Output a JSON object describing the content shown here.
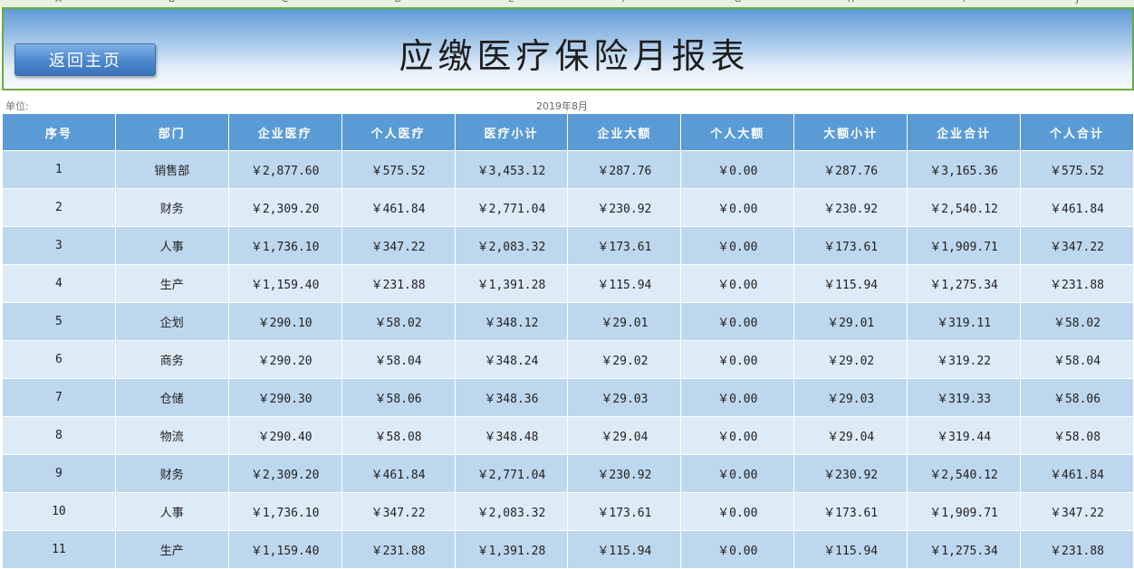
{
  "columns_letters": [
    "A",
    "B",
    "C",
    "D",
    "E",
    "F",
    "G",
    "H",
    "I",
    "J"
  ],
  "home_button": "返回主页",
  "title": "应缴医疗保险月报表",
  "unit_label": "单位:",
  "date_label": "2019年8月",
  "table": {
    "headers": [
      "序号",
      "部门",
      "企业医疗",
      "个人医疗",
      "医疗小计",
      "企业大额",
      "个人大额",
      "大额小计",
      "企业合计",
      "个人合计"
    ],
    "rows": [
      [
        "1",
        "销售部",
        "￥2,877.60",
        "￥575.52",
        "￥3,453.12",
        "￥287.76",
        "￥0.00",
        "￥287.76",
        "￥3,165.36",
        "￥575.52"
      ],
      [
        "2",
        "财务",
        "￥2,309.20",
        "￥461.84",
        "￥2,771.04",
        "￥230.92",
        "￥0.00",
        "￥230.92",
        "￥2,540.12",
        "￥461.84"
      ],
      [
        "3",
        "人事",
        "￥1,736.10",
        "￥347.22",
        "￥2,083.32",
        "￥173.61",
        "￥0.00",
        "￥173.61",
        "￥1,909.71",
        "￥347.22"
      ],
      [
        "4",
        "生产",
        "￥1,159.40",
        "￥231.88",
        "￥1,391.28",
        "￥115.94",
        "￥0.00",
        "￥115.94",
        "￥1,275.34",
        "￥231.88"
      ],
      [
        "5",
        "企划",
        "￥290.10",
        "￥58.02",
        "￥348.12",
        "￥29.01",
        "￥0.00",
        "￥29.01",
        "￥319.11",
        "￥58.02"
      ],
      [
        "6",
        "商务",
        "￥290.20",
        "￥58.04",
        "￥348.24",
        "￥29.02",
        "￥0.00",
        "￥29.02",
        "￥319.22",
        "￥58.04"
      ],
      [
        "7",
        "仓储",
        "￥290.30",
        "￥58.06",
        "￥348.36",
        "￥29.03",
        "￥0.00",
        "￥29.03",
        "￥319.33",
        "￥58.06"
      ],
      [
        "8",
        "物流",
        "￥290.40",
        "￥58.08",
        "￥348.48",
        "￥29.04",
        "￥0.00",
        "￥29.04",
        "￥319.44",
        "￥58.08"
      ],
      [
        "9",
        "财务",
        "￥2,309.20",
        "￥461.84",
        "￥2,771.04",
        "￥230.92",
        "￥0.00",
        "￥230.92",
        "￥2,540.12",
        "￥461.84"
      ],
      [
        "10",
        "人事",
        "￥1,736.10",
        "￥347.22",
        "￥2,083.32",
        "￥173.61",
        "￥0.00",
        "￥173.61",
        "￥1,909.71",
        "￥347.22"
      ],
      [
        "11",
        "生产",
        "￥1,159.40",
        "￥231.88",
        "￥1,391.28",
        "￥115.94",
        "￥0.00",
        "￥115.94",
        "￥1,275.34",
        "￥231.88"
      ]
    ]
  }
}
